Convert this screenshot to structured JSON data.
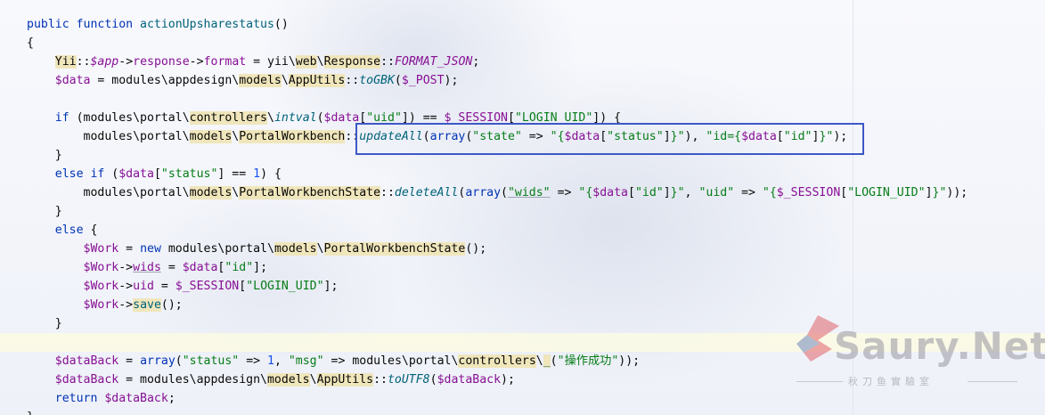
{
  "code_lines": [
    [
      {
        "t": "public function ",
        "c": "kw"
      },
      {
        "t": "actionUpsharestatus",
        "c": "fn"
      },
      {
        "t": "()",
        "c": ""
      }
    ],
    [
      {
        "t": "{",
        "c": ""
      }
    ],
    [
      {
        "t": "    ",
        "c": ""
      },
      {
        "t": "Yii",
        "c": "hl"
      },
      {
        "t": "::",
        "c": ""
      },
      {
        "t": "$app",
        "c": "vari"
      },
      {
        "t": "->",
        "c": ""
      },
      {
        "t": "response",
        "c": "fld"
      },
      {
        "t": "->",
        "c": ""
      },
      {
        "t": "format",
        "c": "fld"
      },
      {
        "t": " = yii\\",
        "c": ""
      },
      {
        "t": "web",
        "c": "hl"
      },
      {
        "t": "\\",
        "c": ""
      },
      {
        "t": "Response",
        "c": "hl"
      },
      {
        "t": "::",
        "c": ""
      },
      {
        "t": "FORMAT_JSON",
        "c": "cst"
      },
      {
        "t": ";",
        "c": ""
      }
    ],
    [
      {
        "t": "    ",
        "c": ""
      },
      {
        "t": "$data",
        "c": "var"
      },
      {
        "t": " = modules\\appdesign\\",
        "c": ""
      },
      {
        "t": "models",
        "c": "hl"
      },
      {
        "t": "\\",
        "c": ""
      },
      {
        "t": "AppUtils",
        "c": "hl"
      },
      {
        "t": "::",
        "c": ""
      },
      {
        "t": "toGBK",
        "c": "sm"
      },
      {
        "t": "(",
        "c": ""
      },
      {
        "t": "$_POST",
        "c": "var"
      },
      {
        "t": ");",
        "c": ""
      }
    ],
    [],
    [
      {
        "t": "    ",
        "c": ""
      },
      {
        "t": "if",
        "c": "kw"
      },
      {
        "t": " (modules\\portal\\",
        "c": ""
      },
      {
        "t": "controllers",
        "c": "hl"
      },
      {
        "t": "\\",
        "c": ""
      },
      {
        "t": "intval",
        "c": "sm"
      },
      {
        "t": "(",
        "c": ""
      },
      {
        "t": "$data",
        "c": "var"
      },
      {
        "t": "[",
        "c": ""
      },
      {
        "t": "\"uid\"",
        "c": "str"
      },
      {
        "t": "]) == ",
        "c": ""
      },
      {
        "t": "$_SESSION",
        "c": "var"
      },
      {
        "t": "[",
        "c": ""
      },
      {
        "t": "\"LOGIN_UID\"",
        "c": "str"
      },
      {
        "t": "]) {",
        "c": ""
      }
    ],
    [
      {
        "t": "        modules\\portal\\",
        "c": ""
      },
      {
        "t": "models",
        "c": "hl"
      },
      {
        "t": "\\",
        "c": ""
      },
      {
        "t": "PortalWorkbench",
        "c": "hl"
      },
      {
        "t": "::",
        "c": ""
      },
      {
        "t": "updateAll",
        "c": "sm"
      },
      {
        "t": "(",
        "c": ""
      },
      {
        "t": "array",
        "c": "kw"
      },
      {
        "t": "(",
        "c": ""
      },
      {
        "t": "\"state\"",
        "c": "str"
      },
      {
        "t": " => ",
        "c": ""
      },
      {
        "t": "\"{",
        "c": "str"
      },
      {
        "t": "$data",
        "c": "var"
      },
      {
        "t": "[",
        "c": ""
      },
      {
        "t": "\"status\"",
        "c": "str"
      },
      {
        "t": "]",
        "c": ""
      },
      {
        "t": "}\"",
        "c": "str"
      },
      {
        "t": "), ",
        "c": ""
      },
      {
        "t": "\"id={",
        "c": "str"
      },
      {
        "t": "$data",
        "c": "var"
      },
      {
        "t": "[",
        "c": ""
      },
      {
        "t": "\"id\"",
        "c": "str"
      },
      {
        "t": "]",
        "c": ""
      },
      {
        "t": "}\"",
        "c": "str"
      },
      {
        "t": ");",
        "c": ""
      }
    ],
    [
      {
        "t": "    }",
        "c": ""
      }
    ],
    [
      {
        "t": "    ",
        "c": ""
      },
      {
        "t": "else if",
        "c": "kw"
      },
      {
        "t": " (",
        "c": ""
      },
      {
        "t": "$data",
        "c": "var"
      },
      {
        "t": "[",
        "c": ""
      },
      {
        "t": "\"status\"",
        "c": "str"
      },
      {
        "t": "] == ",
        "c": ""
      },
      {
        "t": "1",
        "c": "num"
      },
      {
        "t": ") {",
        "c": ""
      }
    ],
    [
      {
        "t": "        modules\\portal\\",
        "c": ""
      },
      {
        "t": "models",
        "c": "hl"
      },
      {
        "t": "\\",
        "c": ""
      },
      {
        "t": "PortalWorkbenchState",
        "c": "hl"
      },
      {
        "t": "::",
        "c": ""
      },
      {
        "t": "deleteAll",
        "c": "sm"
      },
      {
        "t": "(",
        "c": ""
      },
      {
        "t": "array",
        "c": "kw"
      },
      {
        "t": "(",
        "c": ""
      },
      {
        "t": "\"wids\"",
        "c": "str ul"
      },
      {
        "t": " => ",
        "c": ""
      },
      {
        "t": "\"{",
        "c": "str"
      },
      {
        "t": "$data",
        "c": "var"
      },
      {
        "t": "[",
        "c": ""
      },
      {
        "t": "\"id\"",
        "c": "str"
      },
      {
        "t": "]",
        "c": ""
      },
      {
        "t": "}\"",
        "c": "str"
      },
      {
        "t": ", ",
        "c": ""
      },
      {
        "t": "\"uid\"",
        "c": "str"
      },
      {
        "t": " => ",
        "c": ""
      },
      {
        "t": "\"{",
        "c": "str"
      },
      {
        "t": "$_SESSION",
        "c": "var"
      },
      {
        "t": "[",
        "c": ""
      },
      {
        "t": "\"LOGIN_UID\"",
        "c": "str"
      },
      {
        "t": "]",
        "c": ""
      },
      {
        "t": "}\"",
        "c": "str"
      },
      {
        "t": "));",
        "c": ""
      }
    ],
    [
      {
        "t": "    }",
        "c": ""
      }
    ],
    [
      {
        "t": "    ",
        "c": ""
      },
      {
        "t": "else",
        "c": "kw"
      },
      {
        "t": " {",
        "c": ""
      }
    ],
    [
      {
        "t": "        ",
        "c": ""
      },
      {
        "t": "$Work",
        "c": "var"
      },
      {
        "t": " = ",
        "c": ""
      },
      {
        "t": "new",
        "c": "kw"
      },
      {
        "t": " modules\\portal\\",
        "c": ""
      },
      {
        "t": "models",
        "c": "hl"
      },
      {
        "t": "\\",
        "c": ""
      },
      {
        "t": "PortalWorkbenchState",
        "c": "hl"
      },
      {
        "t": "();",
        "c": ""
      }
    ],
    [
      {
        "t": "        ",
        "c": ""
      },
      {
        "t": "$Work",
        "c": "var"
      },
      {
        "t": "->",
        "c": ""
      },
      {
        "t": "wids",
        "c": "fld ul"
      },
      {
        "t": " = ",
        "c": ""
      },
      {
        "t": "$data",
        "c": "var"
      },
      {
        "t": "[",
        "c": ""
      },
      {
        "t": "\"id\"",
        "c": "str"
      },
      {
        "t": "];",
        "c": ""
      }
    ],
    [
      {
        "t": "        ",
        "c": ""
      },
      {
        "t": "$Work",
        "c": "var"
      },
      {
        "t": "->",
        "c": ""
      },
      {
        "t": "uid",
        "c": "fld"
      },
      {
        "t": " = ",
        "c": ""
      },
      {
        "t": "$_SESSION",
        "c": "var"
      },
      {
        "t": "[",
        "c": ""
      },
      {
        "t": "\"LOGIN_UID\"",
        "c": "str"
      },
      {
        "t": "];",
        "c": ""
      }
    ],
    [
      {
        "t": "        ",
        "c": ""
      },
      {
        "t": "$Work",
        "c": "var"
      },
      {
        "t": "->",
        "c": ""
      },
      {
        "t": "save",
        "c": "hl fn"
      },
      {
        "t": "();",
        "c": ""
      }
    ],
    [
      {
        "t": "    }",
        "c": ""
      }
    ],
    [],
    [
      {
        "t": "    ",
        "c": ""
      },
      {
        "t": "$dataBack",
        "c": "var"
      },
      {
        "t": " = ",
        "c": ""
      },
      {
        "t": "array",
        "c": "kw"
      },
      {
        "t": "(",
        "c": ""
      },
      {
        "t": "\"status\"",
        "c": "str"
      },
      {
        "t": " => ",
        "c": ""
      },
      {
        "t": "1",
        "c": "num"
      },
      {
        "t": ", ",
        "c": ""
      },
      {
        "t": "\"msg\"",
        "c": "str"
      },
      {
        "t": " => modules\\portal\\",
        "c": ""
      },
      {
        "t": "controllers",
        "c": "hl"
      },
      {
        "t": "\\",
        "c": ""
      },
      {
        "t": "_",
        "c": "hl fn"
      },
      {
        "t": "(",
        "c": ""
      },
      {
        "t": "\"操作成功\"",
        "c": "str"
      },
      {
        "t": "));",
        "c": ""
      }
    ],
    [
      {
        "t": "    ",
        "c": ""
      },
      {
        "t": "$dataBack",
        "c": "var"
      },
      {
        "t": " = modules\\appdesign\\",
        "c": ""
      },
      {
        "t": "models",
        "c": "hl"
      },
      {
        "t": "\\",
        "c": ""
      },
      {
        "t": "AppUtils",
        "c": "hl"
      },
      {
        "t": "::",
        "c": ""
      },
      {
        "t": "toUTF8",
        "c": "sm"
      },
      {
        "t": "(",
        "c": ""
      },
      {
        "t": "$dataBack",
        "c": "var"
      },
      {
        "t": ");",
        "c": ""
      }
    ],
    [
      {
        "t": "    ",
        "c": ""
      },
      {
        "t": "return",
        "c": "kw"
      },
      {
        "t": " ",
        "c": ""
      },
      {
        "t": "$dataBack",
        "c": "var"
      },
      {
        "t": ";",
        "c": ""
      }
    ],
    [
      {
        "t": "}",
        "c": ""
      }
    ]
  ],
  "watermark": {
    "brand": "Saury.Net",
    "tagline": "秋刀鱼實驗室",
    "colors": {
      "s_logo_red": "#e0606a",
      "s_logo_blue": "#6f86b8"
    }
  },
  "highlight_box_color": "#3d59c6"
}
